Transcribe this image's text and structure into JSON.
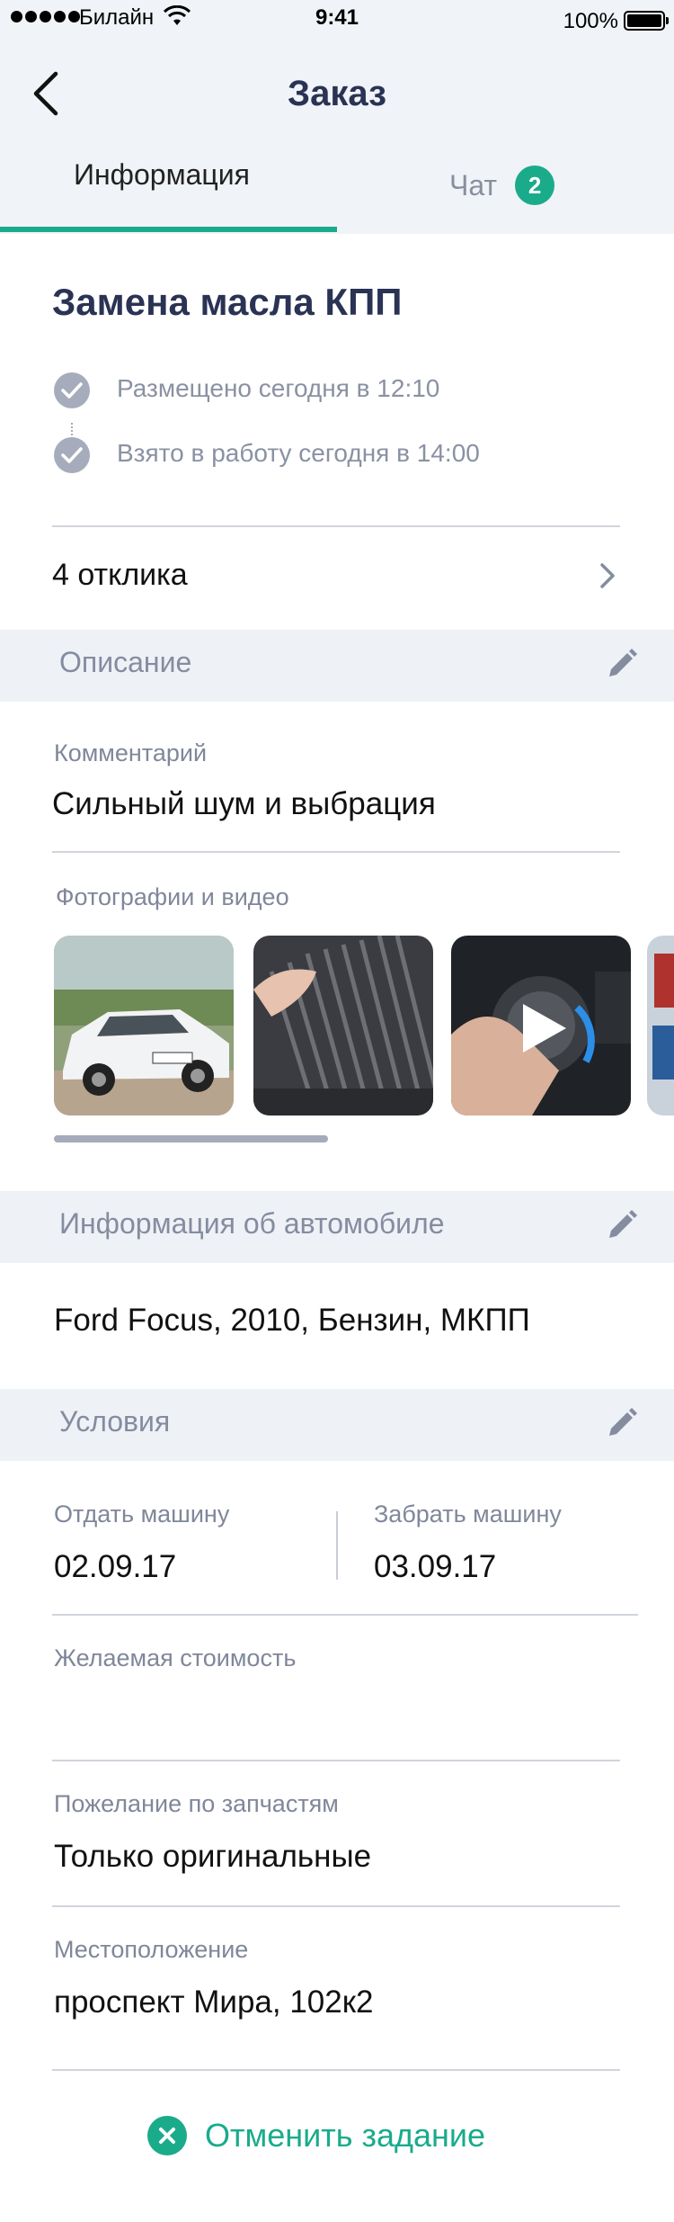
{
  "status_bar": {
    "carrier": "Билайн",
    "time": "9:41",
    "battery_percent": "100%"
  },
  "nav": {
    "title": "Заказ",
    "back_icon": "chevron-left-icon"
  },
  "tabs": [
    {
      "label": "Информация",
      "active": true
    },
    {
      "label": "Чат",
      "badge": "2",
      "active": false
    }
  ],
  "order": {
    "title": "Замена масла КПП",
    "timeline": [
      {
        "text": "Размещено сегодня в 12:10",
        "icon": "check-circle-icon"
      },
      {
        "text": "Взято в работу сегодня в 14:00",
        "icon": "check-circle-icon"
      }
    ],
    "responses_label": "4 отклика"
  },
  "description": {
    "section_title": "Описание",
    "comment_label": "Комментарий",
    "comment_value": "Сильный шум и выбрация",
    "media_label": "Фотографии и видео",
    "media": [
      {
        "kind": "photo",
        "subject": "white car"
      },
      {
        "kind": "photo",
        "subject": "dirty air filter"
      },
      {
        "kind": "video",
        "subject": "car climate control knob"
      },
      {
        "kind": "photo",
        "subject": "car service"
      }
    ]
  },
  "car_info": {
    "section_title": "Информация об автомобиле",
    "value": "Ford Focus, 2010, Бензин, МКПП"
  },
  "conditions": {
    "section_title": "Условия",
    "give_label": "Отдать машину",
    "give_value": "02.09.17",
    "take_label": "Забрать машину",
    "take_value": "03.09.17",
    "price_label": "Желаемая стоимость",
    "price_value": "",
    "parts_label": "Пожелание по запчастям",
    "parts_value": "Только оригинальные",
    "location_label": "Местоположение",
    "location_value": "проспект Мира, 102к2"
  },
  "cancel_button": {
    "label": "Отменить задание",
    "icon": "close-circle-icon"
  },
  "colors": {
    "accent": "#1aab8b",
    "title": "#2a3354",
    "muted": "#858ca0",
    "section_bg": "#eef1f6"
  }
}
